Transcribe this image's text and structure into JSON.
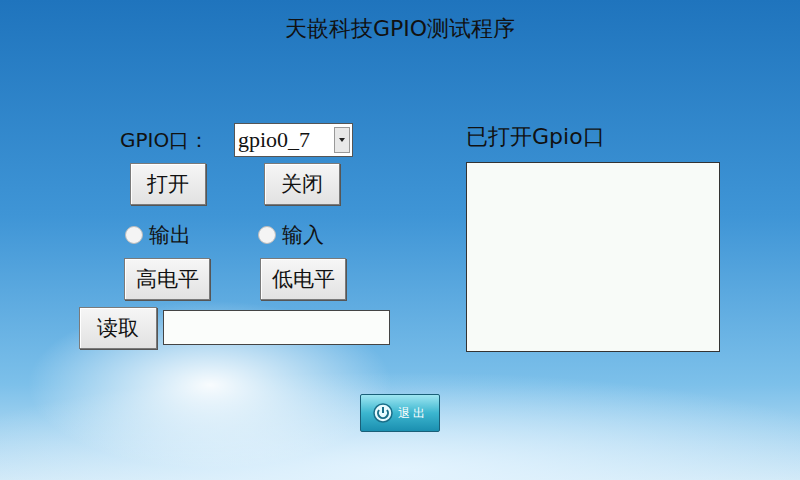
{
  "window": {
    "title": "天嵌科技GPIO测试程序"
  },
  "gpio": {
    "label": "GPIO口：",
    "value": "gpio0_7"
  },
  "port_buttons": [
    "打开",
    "关闭"
  ],
  "direction": [
    {
      "label": "输出",
      "selected": false
    },
    {
      "label": "输入",
      "selected": false
    }
  ],
  "level_buttons": [
    "高电平",
    "低电平"
  ],
  "read": {
    "button": "读取",
    "value": ""
  },
  "opened": {
    "label": "已打开Gpio口",
    "items": []
  },
  "exit": {
    "label": "退出"
  }
}
